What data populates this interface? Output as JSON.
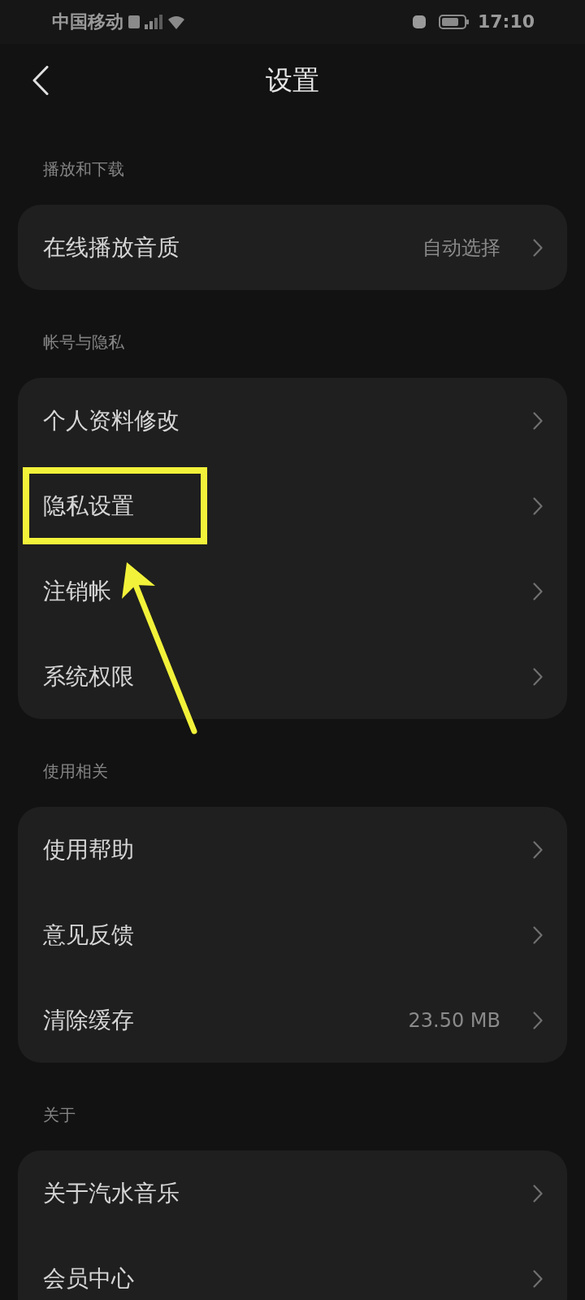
{
  "status_bar": {
    "carrier": "中国移动",
    "time": "17:10"
  },
  "header": {
    "title": "设置"
  },
  "sections": [
    {
      "title": "播放和下载",
      "rows": [
        {
          "label": "在线播放音质",
          "value": "自动选择",
          "highlighted": false
        }
      ]
    },
    {
      "title": "帐号与隐私",
      "rows": [
        {
          "label": "个人资料修改",
          "highlighted": false
        },
        {
          "label": "隐私设置",
          "highlighted": true
        },
        {
          "label": "注销帐",
          "highlighted": false
        },
        {
          "label": "系统权限",
          "highlighted": false
        }
      ]
    },
    {
      "title": "使用相关",
      "rows": [
        {
          "label": "使用帮助",
          "highlighted": false
        },
        {
          "label": "意见反馈",
          "highlighted": false
        },
        {
          "label": "清除缓存",
          "value": "23.50 MB",
          "highlighted": false
        }
      ]
    },
    {
      "title": "关于",
      "rows": [
        {
          "label": "关于汽水音乐",
          "highlighted": false
        },
        {
          "label": "会员中心",
          "highlighted": false
        }
      ]
    }
  ]
}
